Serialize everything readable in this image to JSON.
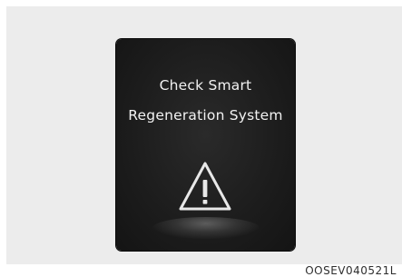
{
  "display": {
    "message_line1": "Check Smart",
    "message_line2": "Regeneration System",
    "icon": "warning-triangle-icon"
  },
  "figure_code": "OOSEV040521L",
  "colors": {
    "screen_background": "#1c1c1c",
    "text": "#f2f2f2",
    "surround": "#ececec"
  }
}
